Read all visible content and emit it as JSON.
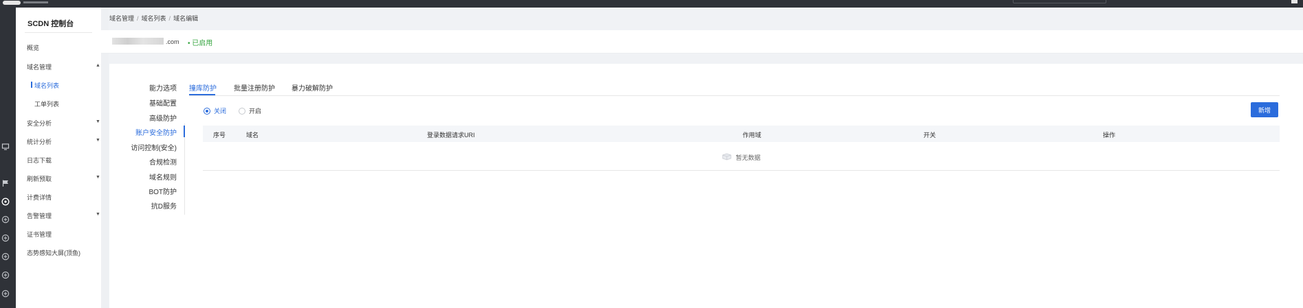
{
  "sidebar": {
    "title": "SCDN 控制台",
    "items": [
      {
        "label": "概览",
        "expandable": false,
        "state": "normal"
      },
      {
        "label": "域名管理",
        "expandable": true,
        "state": "expanded"
      },
      {
        "label": "域名列表",
        "expandable": false,
        "state": "active",
        "sub": true
      },
      {
        "label": "工单列表",
        "expandable": false,
        "state": "normal",
        "sub": true
      },
      {
        "label": "安全分析",
        "expandable": true,
        "state": "collapsed"
      },
      {
        "label": "统计分析",
        "expandable": true,
        "state": "collapsed"
      },
      {
        "label": "日志下载",
        "expandable": false,
        "state": "normal"
      },
      {
        "label": "刷新预取",
        "expandable": true,
        "state": "collapsed"
      },
      {
        "label": "计费详情",
        "expandable": false,
        "state": "normal"
      },
      {
        "label": "告警管理",
        "expandable": true,
        "state": "collapsed"
      },
      {
        "label": "证书管理",
        "expandable": false,
        "state": "normal"
      },
      {
        "label": "态势感知大屏(顶鱼)",
        "expandable": false,
        "state": "normal"
      }
    ]
  },
  "rail_icons": [
    "monitor-icon",
    "flag-icon",
    "shield-icon",
    "shield-icon",
    "shield-icon",
    "shield-icon",
    "shield-icon",
    "shield-icon"
  ],
  "breadcrumb": [
    "域名管理",
    "域名列表",
    "域名编辑"
  ],
  "domain": {
    "suffix": ".com",
    "status": "• 已启用"
  },
  "left_nav": [
    "能力选项",
    "基础配置",
    "高级防护",
    "账户安全防护",
    "访问控制(安全)",
    "合规检测",
    "域名规则",
    "BOT防护",
    "抗D服务"
  ],
  "left_nav_active": "账户安全防护",
  "tabs": [
    "撞库防护",
    "批量注册防护",
    "暴力破解防护"
  ],
  "tab_active": "撞库防护",
  "switch": {
    "options": [
      "关闭",
      "开启"
    ],
    "selected": "关闭"
  },
  "add_button": "新增",
  "table": {
    "columns": [
      "序号",
      "域名",
      "登录数据请求URI",
      "作用域",
      "开关",
      "操作"
    ],
    "rows": [],
    "empty_text": "暂无数据"
  },
  "colors": {
    "primary": "#2b6cdc",
    "enabled_green": "#37a541",
    "dark_chrome": "#2f3238"
  }
}
